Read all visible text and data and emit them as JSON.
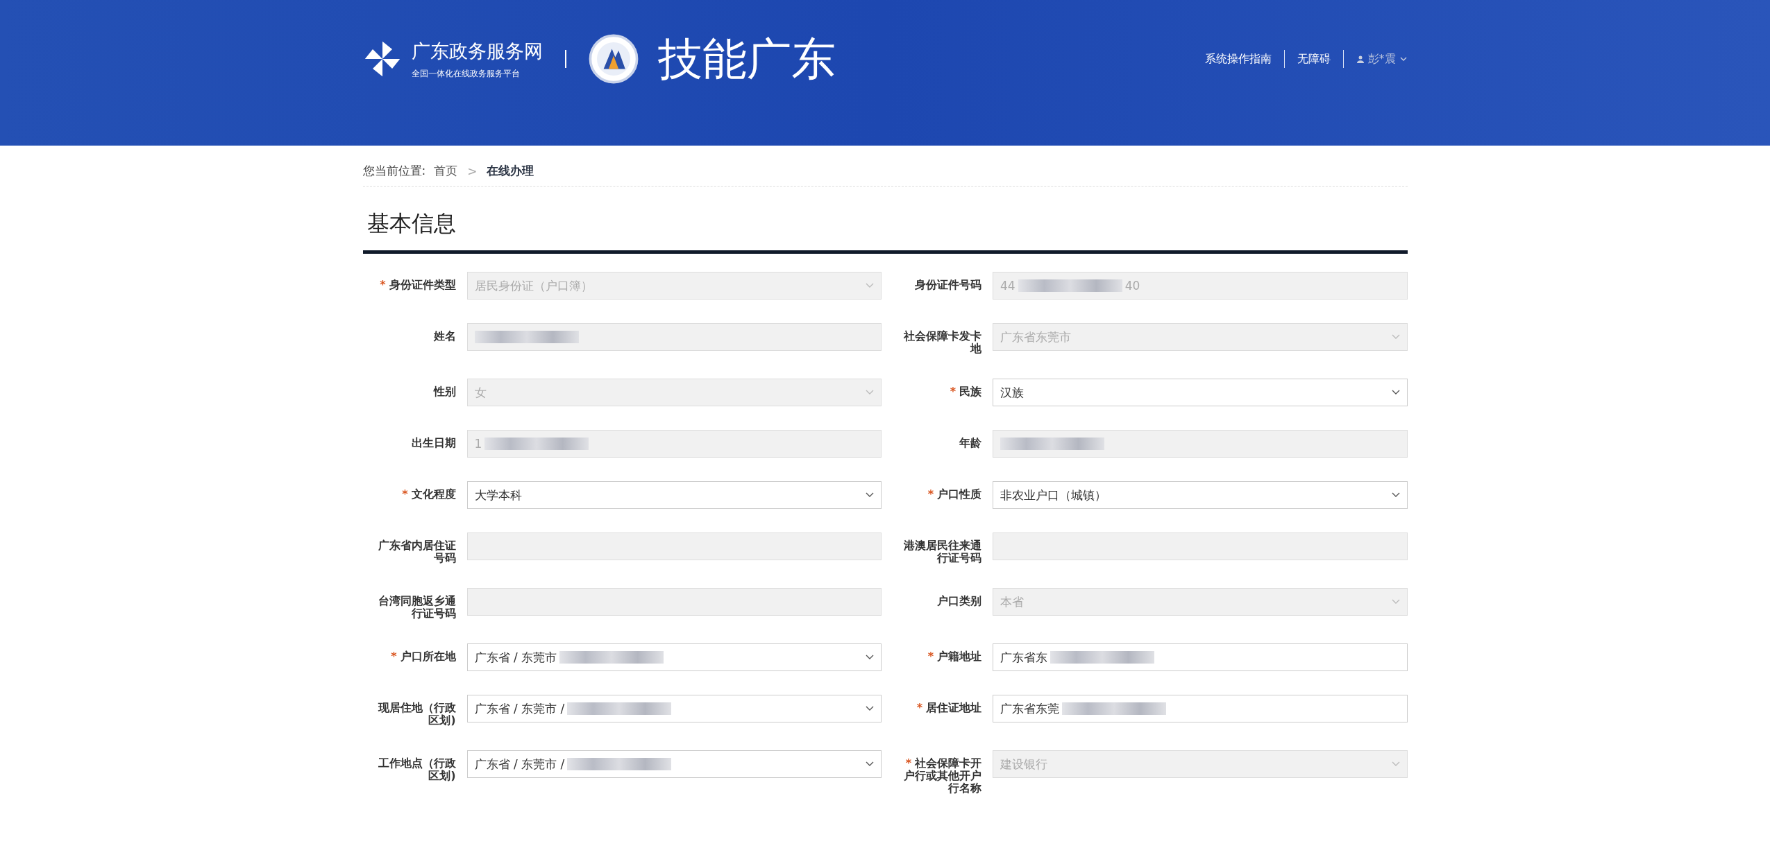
{
  "header": {
    "portal_name": "广东政务服务网",
    "portal_slogan": "全国一体化在线政务服务平台",
    "site_title": "技能广东",
    "links": [
      "系统操作指南",
      "无障碍"
    ],
    "user_name": "彭*震"
  },
  "required_mark": "*",
  "breadcrumb": {
    "label": "您当前位置:",
    "separator": ">",
    "items": [
      {
        "text": "首页",
        "current": false
      },
      {
        "text": "在线办理",
        "current": true
      }
    ]
  },
  "section_title": "基本信息",
  "fields": [
    {
      "label": "身份证件类型",
      "required": true,
      "kind": "select",
      "disabled": true,
      "value": "居民身份证（户口簿）"
    },
    {
      "label": "身份证件号码",
      "required": false,
      "kind": "text",
      "disabled": true,
      "value": "44",
      "redacted": true,
      "value_end": "40"
    },
    {
      "label": "姓名",
      "required": false,
      "kind": "text",
      "disabled": true,
      "redacted": true
    },
    {
      "label": "社会保障卡发卡地",
      "required": false,
      "kind": "select",
      "disabled": true,
      "value": "广东省东莞市"
    },
    {
      "label": "性别",
      "required": false,
      "kind": "select",
      "disabled": true,
      "value": "女"
    },
    {
      "label": "民族",
      "required": true,
      "kind": "select",
      "disabled": false,
      "value": "汉族"
    },
    {
      "label": "出生日期",
      "required": false,
      "kind": "text",
      "disabled": true,
      "value": "1",
      "redacted": true
    },
    {
      "label": "年龄",
      "required": false,
      "kind": "text",
      "disabled": true,
      "redacted": true
    },
    {
      "label": "文化程度",
      "required": true,
      "kind": "select",
      "disabled": false,
      "value": "大学本科"
    },
    {
      "label": "户口性质",
      "required": true,
      "kind": "select",
      "disabled": false,
      "value": "非农业户口（城镇）"
    },
    {
      "label": "广东省内居住证号码",
      "required": false,
      "kind": "text",
      "disabled": true
    },
    {
      "label": "港澳居民往来通行证号码",
      "required": false,
      "kind": "text",
      "disabled": true
    },
    {
      "label": "台湾同胞返乡通行证号码",
      "required": false,
      "kind": "text",
      "disabled": true
    },
    {
      "label": "户口类别",
      "required": false,
      "kind": "select",
      "disabled": true,
      "value": "本省"
    },
    {
      "label": "户口所在地",
      "required": true,
      "kind": "select",
      "disabled": false,
      "value": "广东省 / 东莞市",
      "redacted": true
    },
    {
      "label": "户籍地址",
      "required": true,
      "kind": "text",
      "disabled": false,
      "value": "广东省东",
      "redacted": true
    },
    {
      "label": "现居住地（行政区划)",
      "required": false,
      "kind": "select",
      "disabled": false,
      "value": "广东省 / 东莞市 /",
      "redacted": true
    },
    {
      "label": "居住证地址",
      "required": true,
      "kind": "text",
      "disabled": false,
      "value": "广东省东莞",
      "redacted": true
    },
    {
      "label": "工作地点（行政区划)",
      "required": false,
      "kind": "select",
      "disabled": false,
      "value": "广东省 / 东莞市 /",
      "redacted": true
    },
    {
      "label": "社会保障卡开户行或其他开户行名称",
      "required": true,
      "kind": "select",
      "disabled": true,
      "value": "建设银行"
    }
  ]
}
